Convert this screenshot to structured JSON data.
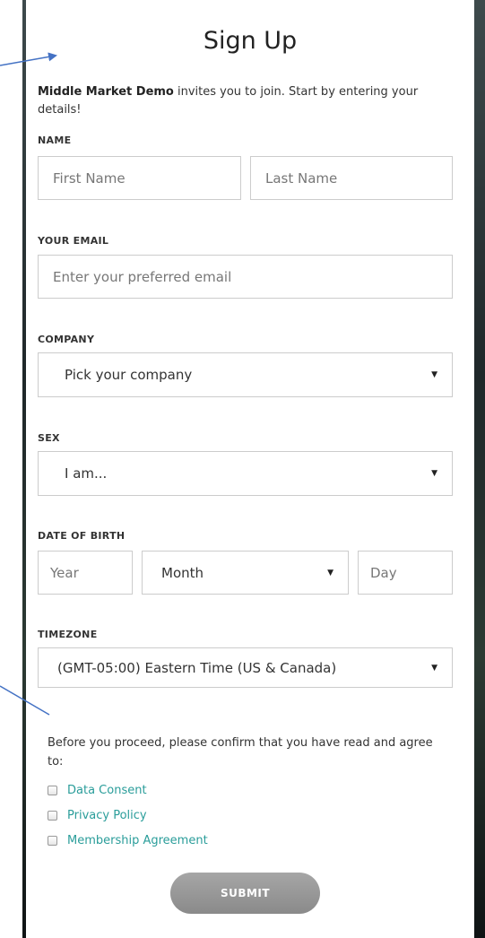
{
  "title": "Sign Up",
  "intro": {
    "org_name": "Middle Market Demo",
    "text": " invites you to join. Start by entering your details!"
  },
  "name": {
    "label": "NAME",
    "first_placeholder": "First Name",
    "last_placeholder": "Last Name"
  },
  "email": {
    "label": "YOUR EMAIL",
    "placeholder": "Enter your preferred email"
  },
  "company": {
    "label": "COMPANY",
    "value": "Pick your company"
  },
  "sex": {
    "label": "SEX",
    "value": "I am..."
  },
  "dob": {
    "label": "DATE OF BIRTH",
    "year_placeholder": "Year",
    "month_value": "Month",
    "day_placeholder": "Day"
  },
  "timezone": {
    "label": "TIMEZONE",
    "value": "(GMT-05:00) Eastern Time (US & Canada)"
  },
  "consent": {
    "text": "Before you proceed, please confirm that you have read and agree to:",
    "items": [
      {
        "label": "Data Consent"
      },
      {
        "label": "Privacy Policy"
      },
      {
        "label": "Membership Agreement"
      }
    ]
  },
  "submit_label": "SUBMIT",
  "colors": {
    "link": "#2a9d9a",
    "annotation_arrow": "#4472c4",
    "submit_button": "#999999"
  }
}
